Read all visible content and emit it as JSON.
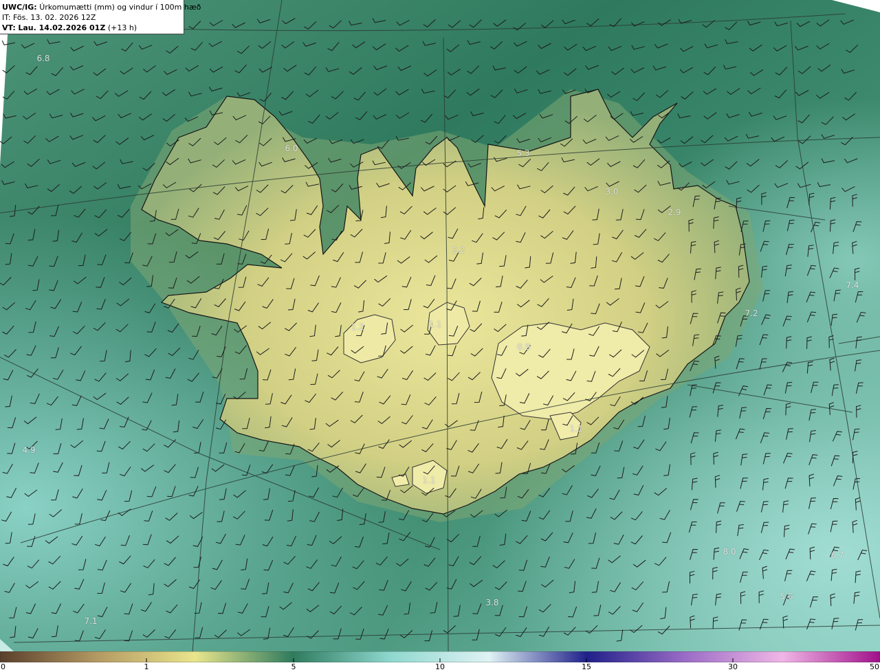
{
  "title": {
    "model": "UWC/IG:",
    "description": "Úrkomumætti (mm) og vindur í 100m hæð",
    "init_time": "IT: Fös. 13. 02. 2026 12Z",
    "valid_prefix": "VT:",
    "valid_time": "Lau. 14.02.2026 01Z",
    "lead": "(+13 h)"
  },
  "value_labels": [
    {
      "id": "nw-ocean",
      "text": "6.8"
    },
    {
      "id": "westfjords-north",
      "text": "6.0"
    },
    {
      "id": "north-coast",
      "text": "5.3"
    },
    {
      "id": "northeast",
      "text": "3.0"
    },
    {
      "id": "east-fjords",
      "text": "2.9"
    },
    {
      "id": "interior-north",
      "text": "2.2"
    },
    {
      "id": "langjokull",
      "text": "1.2"
    },
    {
      "id": "hofsjokull",
      "text": "1.1"
    },
    {
      "id": "vatnajokull",
      "text": "0.9"
    },
    {
      "id": "oraefajokull",
      "text": "1.1"
    },
    {
      "id": "myrdalsjokull",
      "text": "1.1"
    },
    {
      "id": "east-ocean",
      "text": "7.4"
    },
    {
      "id": "east-coast-offshore",
      "text": "7.2"
    },
    {
      "id": "sw-ocean",
      "text": "4.9"
    },
    {
      "id": "se-ocean",
      "text": "8.0"
    },
    {
      "id": "se-ocean-far",
      "text": "6.7"
    },
    {
      "id": "south-ocean",
      "text": "3.8"
    },
    {
      "id": "se-ocean-south",
      "text": "5.6"
    },
    {
      "id": "sw-ocean-south",
      "text": "7.1"
    }
  ],
  "colorbar": {
    "ticks": [
      "0",
      "1",
      "5",
      "10",
      "15",
      "30",
      "50"
    ],
    "colors": [
      "#5a3f2c",
      "#b49a63",
      "#e9e58c",
      "#2f7b5e",
      "#8fd8cf",
      "#dff2f4",
      "#20208a",
      "#9a6cc6",
      "#f0b6e6",
      "#a0108a"
    ]
  },
  "colors": {
    "ocean": "#3f8a6e",
    "land_low": "#c9cc7c",
    "land_high": "#e8e59a",
    "coast": "#141414",
    "grid": "#2a3a32"
  }
}
